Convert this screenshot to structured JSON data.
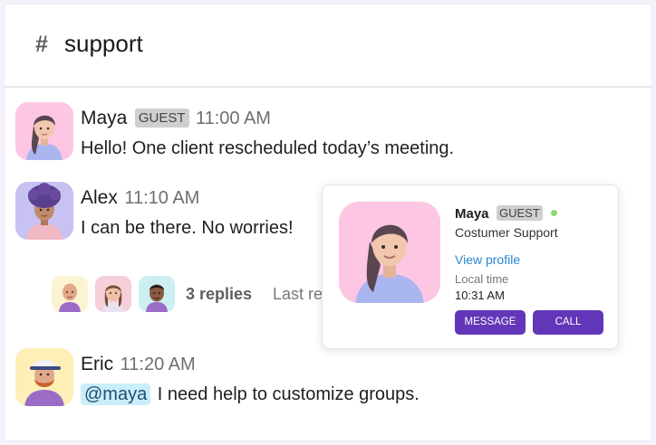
{
  "channel": {
    "hash": "#",
    "name": "support"
  },
  "messages": [
    {
      "author": "Maya",
      "badge": "GUEST",
      "time": "11:00 AM",
      "text": "Hello! One client rescheduled today’s meeting.",
      "avatar": "maya-avatar",
      "avatar_bg": "#fdc6e3"
    },
    {
      "author": "Alex",
      "time": "11:10 AM",
      "text": "I can be there. No worries!",
      "avatar": "alex-avatar",
      "avatar_bg": "#c7c2f2"
    },
    {
      "author": "Eric",
      "time": "11:20 AM",
      "mention": "@maya",
      "text": "I need help to customize groups.",
      "avatar": "eric-avatar",
      "avatar_bg": "#fdefb6"
    }
  ],
  "thread": {
    "replies_label": "3 replies",
    "last_label": "Last re",
    "participant_avatars": [
      "bald-avatar",
      "woman-avatar",
      "man-avatar"
    ]
  },
  "profile_card": {
    "name": "Maya",
    "badge": "GUEST",
    "status": "online",
    "role": "Costumer Support",
    "view_profile": "View profile",
    "local_time_label": "Local time",
    "local_time": "10:31 AM",
    "message_button": "MESSAGE",
    "call_button": "CALL"
  },
  "colors": {
    "accent": "#6236b8",
    "link": "#2a85d0",
    "mention_bg": "#c9eefa",
    "online": "#8fd86b",
    "badge_bg": "#cfcfcf"
  }
}
